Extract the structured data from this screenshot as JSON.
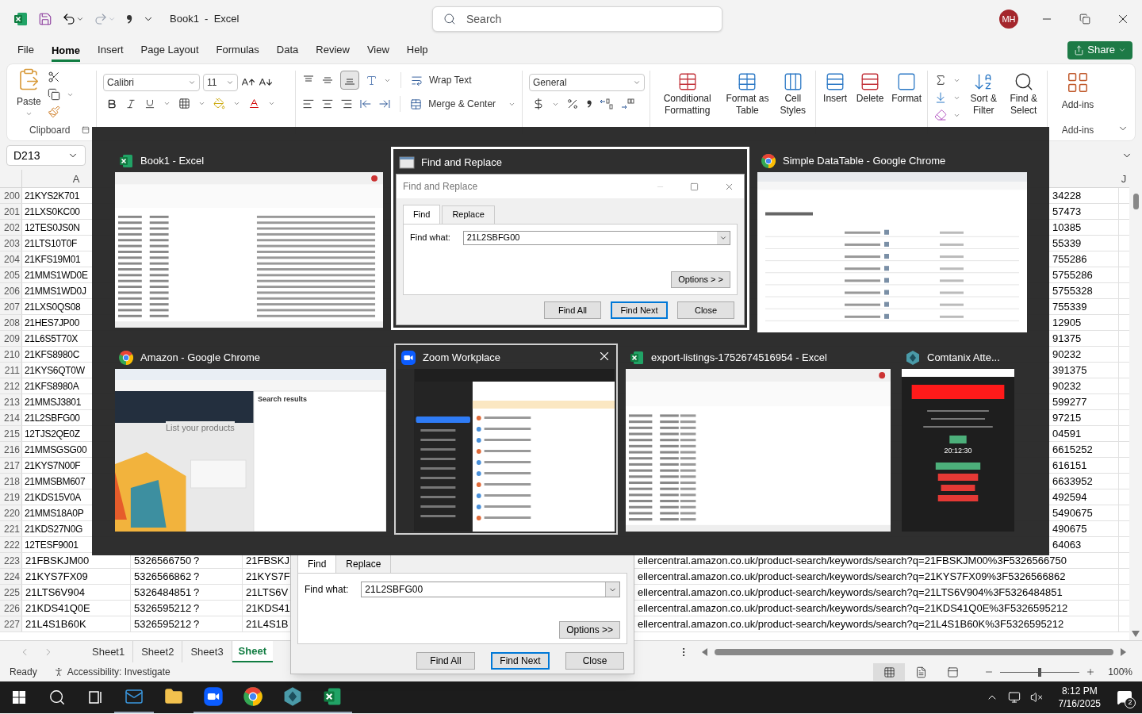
{
  "window": {
    "title": "Book1  -  Excel",
    "search_placeholder": "Search",
    "account": "MH"
  },
  "menu": [
    {
      "label": "File",
      "selected": false
    },
    {
      "label": "Home",
      "selected": true
    },
    {
      "label": "Insert",
      "selected": false
    },
    {
      "label": "Page Layout",
      "selected": false
    },
    {
      "label": "Formulas",
      "selected": false
    },
    {
      "label": "Data",
      "selected": false
    },
    {
      "label": "Review",
      "selected": false
    },
    {
      "label": "View",
      "selected": false
    },
    {
      "label": "Help",
      "selected": false
    }
  ],
  "share": "Share",
  "ribbon": {
    "clipboard": {
      "paste": "Paste",
      "label": "Clipboard"
    },
    "font": {
      "name": "Calibri",
      "size": "11"
    },
    "alignment": {
      "wrap_text": "Wrap Text",
      "merge": "Merge & Center",
      "bottom_align_selected": true
    },
    "number": {
      "format": "General"
    },
    "styles": [
      "Conditional Formatting",
      "Format as Table",
      "Cell Styles"
    ],
    "cells": [
      "Insert",
      "Delete",
      "Format"
    ],
    "editing": [
      "Sort & Filter",
      "Find & Select"
    ],
    "addins": {
      "button": "Add-ins",
      "label": "Add-ins"
    }
  },
  "formula_bar": {
    "name_box": "D213"
  },
  "column_headers": [
    "A",
    "J"
  ],
  "rows": [
    {
      "number": "200",
      "column_a": "21KYS2K701",
      "tail": "34228"
    },
    {
      "number": "201",
      "column_a": "21LXS0KC00",
      "tail": "57473"
    },
    {
      "number": "202",
      "column_a": "12TES0JS0N",
      "tail": "10385"
    },
    {
      "number": "203",
      "column_a": "21LTS10T0F",
      "tail": "55339"
    },
    {
      "number": "204",
      "column_a": "21KFS19M01",
      "tail": "755286"
    },
    {
      "number": "205",
      "column_a": "21MMS1WD0E",
      "tail": "5755286"
    },
    {
      "number": "206",
      "column_a": "21MMS1WD0J",
      "tail": "5755328"
    },
    {
      "number": "207",
      "column_a": "21LXS0QS08",
      "tail": "755339"
    },
    {
      "number": "208",
      "column_a": "21HES7JP00",
      "tail": "12905"
    },
    {
      "number": "209",
      "column_a": "21L6S5T70X",
      "tail": "91375"
    },
    {
      "number": "210",
      "column_a": "21KFS8980C",
      "tail": "90232"
    },
    {
      "number": "211",
      "column_a": "21KYS6QT0W",
      "tail": "391375"
    },
    {
      "number": "212",
      "column_a": "21KFS8980A",
      "tail": "90232"
    },
    {
      "number": "213",
      "column_a": "21MMSJ3801",
      "tail": "599277"
    },
    {
      "number": "214",
      "column_a": "21L2SBFG00",
      "tail": "97215"
    },
    {
      "number": "215",
      "column_a": "12TJS2QE0Z",
      "tail": "04591"
    },
    {
      "number": "216",
      "column_a": "21MMSGSG00",
      "tail": "6615252"
    },
    {
      "number": "217",
      "column_a": "21KYS7N00F",
      "tail": "616151"
    },
    {
      "number": "218",
      "column_a": "21MMSBM607",
      "tail": "6633952"
    },
    {
      "number": "219",
      "column_a": "21KDS15V0A",
      "tail": "492594"
    },
    {
      "number": "220",
      "column_a": "21MMS18A0P",
      "tail": "5490675"
    },
    {
      "number": "221",
      "column_a": "21KDS27N0G",
      "tail": "490675"
    },
    {
      "number": "222",
      "column_a": "12TESF9001",
      "tail": "64063"
    }
  ],
  "rows_below": [
    {
      "number": "223",
      "column_a": "21FBSKJM00",
      "column_b": "5326566750",
      "column_c": "?",
      "column_d": "21FBSKJ",
      "url": "ellercentral.amazon.co.uk/product-search/keywords/search?q=21FBSKJM00%3F5326566750"
    },
    {
      "number": "224",
      "column_a": "21KYS7FX09",
      "column_b": "5326566862",
      "column_c": "?",
      "column_d": "21KYS7F",
      "url": "ellercentral.amazon.co.uk/product-search/keywords/search?q=21KYS7FX09%3F5326566862"
    },
    {
      "number": "225",
      "column_a": "21LTS6V904",
      "column_b": "5326484851",
      "column_c": "?",
      "column_d": "21LTS6V",
      "url": "ellercentral.amazon.co.uk/product-search/keywords/search?q=21LTS6V904%3F5326484851"
    },
    {
      "number": "226",
      "column_a": "21KDS41Q0E",
      "column_b": "5326595212",
      "column_c": "?",
      "column_d": "21KDS41",
      "url": "ellercentral.amazon.co.uk/product-search/keywords/search?q=21KDS41Q0E%3F5326595212"
    },
    {
      "number": "227",
      "column_a": "21L4S1B60K",
      "column_b": "5326595212",
      "column_c": "?",
      "column_d": "21L4S1B",
      "url": "ellercentral.amazon.co.uk/product-search/keywords/search?q=21L4S1B60K%3F5326595212"
    }
  ],
  "sheet_tabs": [
    {
      "label": "Sheet1",
      "selected": false
    },
    {
      "label": "Sheet2",
      "selected": false
    },
    {
      "label": "Sheet3",
      "selected": false
    },
    {
      "label": "Sheet",
      "selected": true
    }
  ],
  "status": {
    "ready": "Ready",
    "accessibility": "Accessibility: Investigate",
    "views": [
      {
        "kind": "normal",
        "selected": true
      },
      {
        "kind": "page_layout",
        "selected": false
      },
      {
        "kind": "page_break",
        "selected": false
      }
    ],
    "zoom_slider": {
      "level": 0.5
    },
    "zoom": "100%"
  },
  "task_switcher": [
    [
      {
        "title": "Book1 - Excel",
        "kind": "excel_workbook",
        "selected": false,
        "hovered": false
      },
      {
        "title": "Find and Replace",
        "kind": "find_dialog",
        "selected": true,
        "hovered": false,
        "dialog": {
          "title": "Find and Replace",
          "tabs": [
            {
              "label": "Find",
              "selected": true
            },
            {
              "label": "Replace",
              "selected": false
            }
          ],
          "find_label": "Find what:",
          "value": "21L2SBFG00",
          "options": "Options > >",
          "buttons": [
            "Find All",
            "Find Next",
            "Close"
          ]
        }
      },
      {
        "title": "Simple DataTable - Google Chrome",
        "kind": "chrome_table",
        "selected": false,
        "hovered": false
      }
    ],
    [
      {
        "title": "Amazon - Google Chrome",
        "kind": "chrome_amazon",
        "selected": false,
        "hovered": false,
        "texts": [
          "List your products",
          "Search results"
        ]
      },
      {
        "title": "Zoom Workplace",
        "kind": "zoom_chat",
        "selected": false,
        "hovered": true
      },
      {
        "title": "export-listings-1752674516954 - Excel",
        "kind": "excel_export",
        "selected": false,
        "hovered": false
      },
      {
        "title": "Comtanix Atte...",
        "kind": "comtanix_attendance",
        "selected": false,
        "hovered": false,
        "texts": [
          "20:12:30"
        ]
      }
    ]
  ],
  "find_dialog": {
    "tabs": [
      {
        "label": "Find",
        "selected": true
      },
      {
        "label": "Replace",
        "selected": false
      }
    ],
    "find_label": "Find what:",
    "value": "21L2SBFG00",
    "options": "Options >>",
    "buttons": [
      {
        "label": "Find All",
        "default": false
      },
      {
        "label": "Find Next",
        "default": true
      },
      {
        "label": "Close",
        "default": false
      }
    ]
  },
  "taskbar": {
    "apps": [
      {
        "kind": "outlook",
        "running": true
      },
      {
        "kind": "explorer",
        "running": false
      },
      {
        "kind": "zoom",
        "running": true
      },
      {
        "kind": "chrome",
        "running": true
      },
      {
        "kind": "comtanix",
        "running": true
      },
      {
        "kind": "excel",
        "running": true
      }
    ],
    "time": "8:12 PM",
    "date": "7/16/2025",
    "notifications": "2"
  }
}
